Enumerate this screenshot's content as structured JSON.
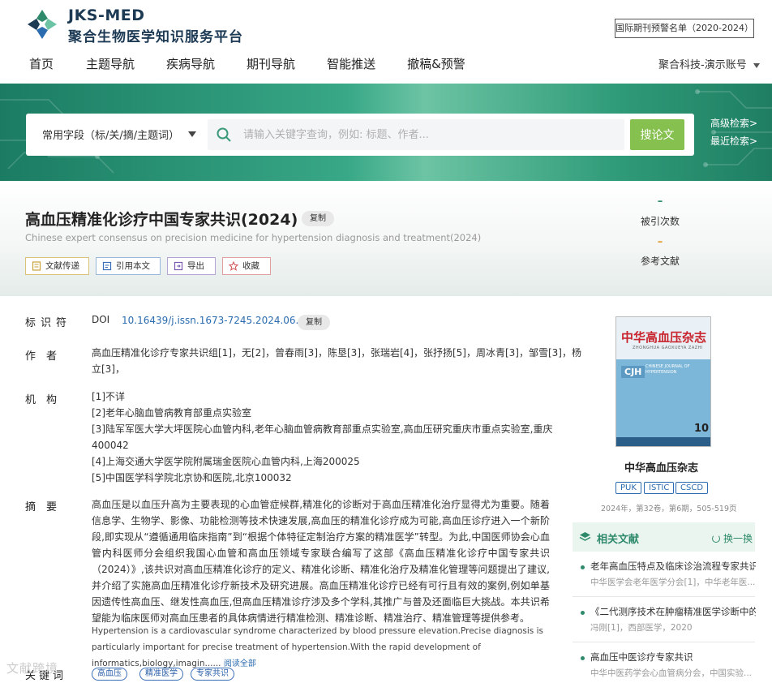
{
  "header": {
    "brand_en": "JKS-MED",
    "brand_cn": "聚合生物医学知识服务平台",
    "warn_button": "国际期刊预警名单（2020-2024）",
    "nav": [
      "首页",
      "主题导航",
      "疾病导航",
      "期刊导航",
      "智能推送",
      "撤稿&预警"
    ],
    "account": "聚合科技-演示账号"
  },
  "search": {
    "field_select": "常用字段（标/关/摘/主题词）",
    "placeholder": "请输入关键字查询，例如: 标题、作者...",
    "button": "搜论文",
    "advanced": "高级检索>",
    "recent": "最近检索>"
  },
  "paper": {
    "title": "高血压精准化诊疗中国专家共识(2024)",
    "copy": "复制",
    "title_en": "Chinese expert consensus on precision medicine for hypertension diagnosis and treatment(2024)",
    "actions": [
      "文献传递",
      "引用本文",
      "导出",
      "收藏"
    ],
    "metrics": [
      {
        "value": "–",
        "label": "被引次数",
        "color": "#2e8a6a"
      },
      {
        "value": "–",
        "label": "参考文献",
        "color": "#e09a2b"
      }
    ]
  },
  "detail": {
    "id_label": "标识符",
    "doi_prefix": "DOI",
    "doi": "10.16439/j.issn.1673-7245.2024.06.002",
    "doi_copy": "复制",
    "author_label": "作　者",
    "authors_line1": "高血压精准化诊疗专家共识组[1]，无[2]，曾春雨[3]，陈垦[3]，张瑞岩[4]，张抒扬[5]，周冰青[3]，邹雪[3]，杨",
    "authors_line2": "立[3]，",
    "affil_label": "机　构",
    "affiliations": [
      "[1]不详",
      "[2]老年心脑血管病教育部重点实验室",
      "[3]陆军军医大学大坪医院心血管内科,老年心脑血管病教育部重点实验室,高血压研究重庆市重点实验室,重庆",
      "400042",
      "[4]上海交通大学医学院附属瑞金医院心血管内科,上海200025",
      "[5]中国医学科学院北京协和医院,北京100032"
    ],
    "abstract_label": "摘　要",
    "abstract": "高血压是以血压升高为主要表现的心血管症候群,精准化的诊断对于高血压精准化治疗显得尤为重要。随着信息学、生物学、影像、功能检测等技术快速发展,高血压的精准化诊疗成为可能,高血压诊疗进入一个新阶段,即实现从“遵循通用临床指南”到“根据个体特征定制治疗方案的精准医学”转型。为此,中国医师协会心血管内科医师分会组织我国心血管和高血压领域专家联合编写了这部《高血压精准化诊疗中国专家共识（2024）》,该共识对高血压精准化诊疗的定义、精准化诊断、精准化治疗及精准化管理等问题提出了建议,并介绍了实施高血压精准化诊疗新技术及研究进展。高血压精准化诊疗已经有可行且有效的案例,例如单基因遗传性高血压、继发性高血压,但高血压精准诊疗涉及多个学科,其推广与普及还面临巨大挑战。本共识希望能为临床医师对高血压患者的具体病情进行精准检测、精准诊断、精准治疗、精准管理等提供参考。",
    "abstract_en": "Hypertension is a cardiovascular syndrome characterized by blood pressure elevation.Precise diagnosis is particularly important for precise treatment of hypertension.With the rapid development of informatics,biology,imagin......",
    "read_all": "阅读全部",
    "keywords_label": "关键词",
    "keywords": [
      "高血压",
      "精准医学",
      "专家共识"
    ]
  },
  "journal": {
    "cover_title": "中华高血压杂志",
    "cover_pinyin": "ZHONGHUA GAOXUEYA ZAZHI",
    "cover_cjh": "CJH",
    "cover_sub": "CHINESE JOURNAL OF HYPERTENSION",
    "cover_issue": "10",
    "name": "中华高血压杂志",
    "badges": [
      "PUK",
      "ISTIC",
      "CSCD"
    ],
    "info": "2024年，第32卷，第6期，505-519页"
  },
  "related": {
    "title": "相关文献",
    "refresh": "换一换",
    "items": [
      {
        "title": "老年高血压特点及临床诊治流程专家共识...",
        "source": "中华医学会老年医学分会[1]，中华老年医..."
      },
      {
        "title": "《二代测序技术在肿瘤精准医学诊断中的...",
        "source": "冯刚[1]，西部医学，2020"
      },
      {
        "title": "高血压中医诊疗专家共识",
        "source": "中华中医药学会心血管病分会，中国实验..."
      }
    ]
  },
  "watermark": "文献跨境"
}
